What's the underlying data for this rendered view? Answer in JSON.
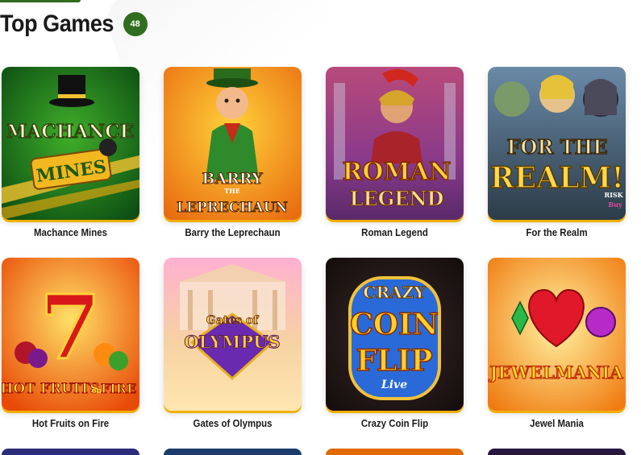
{
  "section": {
    "title": "Top Games",
    "count": "48"
  },
  "games": [
    {
      "title": "Machance Mines",
      "art": [
        "MACHANCE",
        "MINES"
      ]
    },
    {
      "title": "Barry the Leprechaun",
      "art": [
        "BARRY",
        "THE",
        "LEPRECHAUN"
      ]
    },
    {
      "title": "Roman Legend",
      "art": [
        "ROMAN",
        "LEGEND"
      ]
    },
    {
      "title": "For the Realm",
      "art": [
        "FOR THE",
        "REALM!",
        "RISK",
        "Buy"
      ]
    },
    {
      "title": "Hot Fruits on Fire",
      "art": [
        "7",
        "HOT FRUITS",
        "on",
        "FIRE"
      ]
    },
    {
      "title": "Gates of Olympus",
      "art": [
        "Gates of",
        "OLYMPUS"
      ]
    },
    {
      "title": "Crazy Coin Flip",
      "art": [
        "CRAZY",
        "COIN",
        "FLIP",
        "Live"
      ]
    },
    {
      "title": "Jewel Mania",
      "art": [
        "JEWELMANIA"
      ]
    }
  ],
  "colors": {
    "brand_green": "#2f6d1f",
    "card_accent": "#f0b000"
  },
  "next_row_colors": [
    "#2b2d7a",
    "#1c3c6e",
    "#e06a00",
    "#2a1740"
  ]
}
